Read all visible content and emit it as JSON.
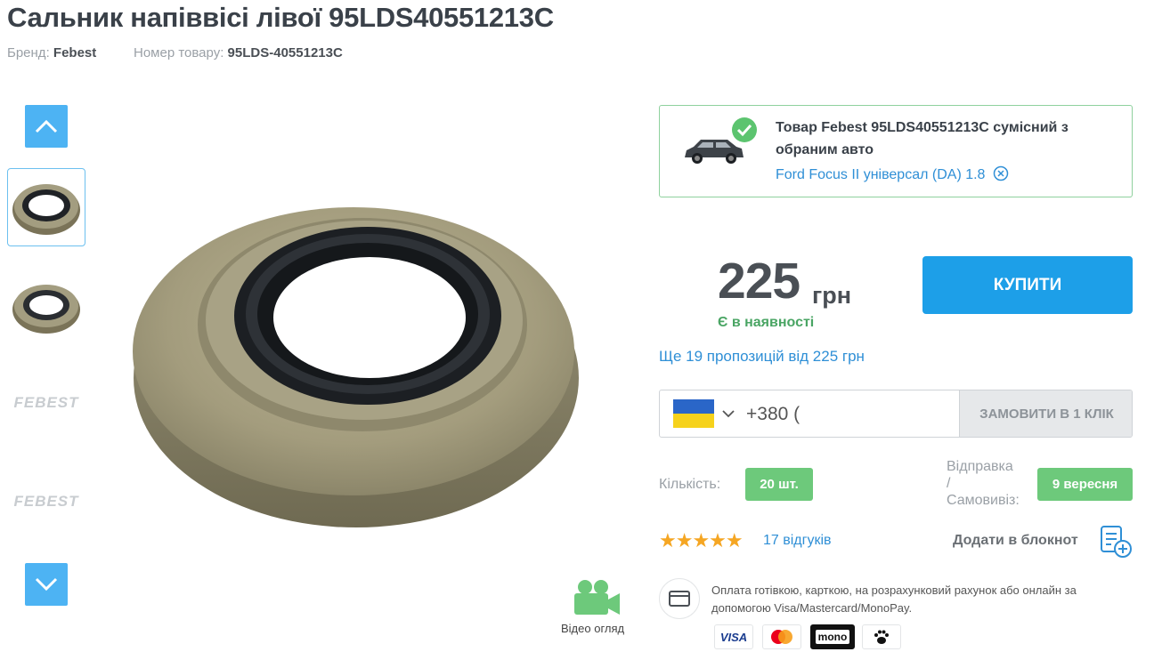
{
  "product": {
    "title": "Сальник напіввісі лівої 95LDS40551213C",
    "brand_label": "Бренд:",
    "brand": "Febest",
    "sku_label": "Номер товару:",
    "sku": "95LDS-40551213C"
  },
  "gallery": {
    "video_label": "Відео огляд",
    "thumb_text": "FEBEST"
  },
  "compat": {
    "title": "Товар Febest 95LDS40551213C сумісний з обраним авто",
    "car": "Ford Focus II універсал (DA) 1.8"
  },
  "price": {
    "value": "225",
    "currency": "грн",
    "stock": "Є в наявності"
  },
  "buy_label": "КУПИТИ",
  "offers": "Ще 19 пропозицій від 225 грн",
  "phone": {
    "value": "+380 (",
    "order_label": "ЗАМОВИТИ В 1 КЛІК"
  },
  "quantity": {
    "label": "Кількість:",
    "value": "20 шт."
  },
  "shipping": {
    "label_1": "Відправка",
    "label_2": "/",
    "label_3": "Самовивіз:",
    "date": "9 вересня"
  },
  "rating": {
    "stars": "★★★★★",
    "stars_value": 5,
    "reviews": "17 відгуків"
  },
  "notebook_label": "Додати в блокнот",
  "payment": {
    "text": "Оплата готівкою, карткою, на розрахунковий рахунок або онлайн за допомогою Visa/Mastercard/MonoPay.",
    "visa": "VISA",
    "mono": "mono"
  },
  "colors": {
    "accent": "#1d9fe8",
    "nav_arrow": "#4db3f3",
    "success": "#6dc97b",
    "link": "#2f8fd6",
    "star": "#f5a623"
  }
}
